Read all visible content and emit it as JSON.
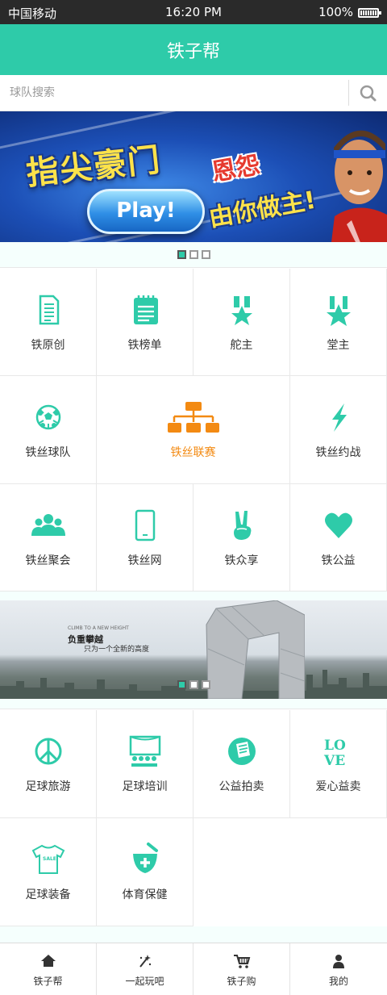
{
  "status_bar": {
    "carrier": "中国移动",
    "time": "16:20 PM",
    "battery": "100%",
    "battery_level": 1.0
  },
  "header": {
    "title": "铁子帮"
  },
  "search": {
    "placeholder": "球队搜索",
    "icon": "search-icon"
  },
  "banner_top": {
    "headline": "指尖豪门",
    "headline_accent": "恩怨",
    "tagline": "由你做主!",
    "button_label": "Play!",
    "dots": {
      "count": 3,
      "active": 0
    }
  },
  "grid_top": [
    {
      "label": "铁原创",
      "icon": "document-icon"
    },
    {
      "label": "铁榜单",
      "icon": "notepad-icon"
    },
    {
      "label": "舵主",
      "icon": "medal-icon"
    },
    {
      "label": "堂主",
      "icon": "star-medal-icon"
    },
    {
      "label": "铁丝球队",
      "icon": "soccer-ball-icon"
    },
    {
      "label": "铁丝联赛",
      "icon": "org-chart-icon",
      "featured": true
    },
    {
      "label": "铁丝约战",
      "icon": "lightning-icon"
    },
    {
      "label": "铁丝聚会",
      "icon": "group-icon"
    },
    {
      "label": "铁丝网",
      "icon": "phone-icon"
    },
    {
      "label": "铁众享",
      "icon": "peace-hand-icon"
    },
    {
      "label": "铁公益",
      "icon": "heart-icon"
    }
  ],
  "banner_mid": {
    "english_line": "CLIMB TO A NEW HEIGHT",
    "headline": "负重攀越",
    "subline": "只为一个全新的高度",
    "dots": {
      "count": 3,
      "active": 0
    }
  },
  "grid_bottom": [
    {
      "label": "足球旅游",
      "icon": "peace-sign-icon"
    },
    {
      "label": "足球培训",
      "icon": "classroom-icon"
    },
    {
      "label": "公益拍卖",
      "icon": "auction-note-icon"
    },
    {
      "label": "爱心益卖",
      "icon": "love-text-icon",
      "icon_text": "LOVE"
    },
    {
      "label": "足球装备",
      "icon": "tshirt-icon",
      "icon_text": "SALE"
    },
    {
      "label": "体育保健",
      "icon": "mortar-cross-icon"
    }
  ],
  "tab_bar": [
    {
      "label": "铁子帮",
      "icon": "home-icon"
    },
    {
      "label": "一起玩吧",
      "icon": "sparkle-icon"
    },
    {
      "label": "铁子购",
      "icon": "cart-icon"
    },
    {
      "label": "我的",
      "icon": "user-icon"
    }
  ],
  "colors": {
    "accent": "#2ecba9",
    "featured": "#f38a12",
    "status_bar": "#2a2a2a"
  }
}
